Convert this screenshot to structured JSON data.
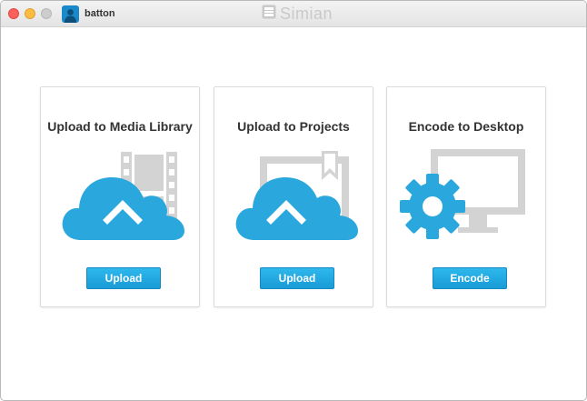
{
  "titlebar": {
    "username": "batton",
    "brand": "Simian",
    "icons": [
      "close-light",
      "minimize-light",
      "maximize-light",
      "user-avatar-icon",
      "simian-logo-icon"
    ]
  },
  "cards": [
    {
      "title": "Upload to Media Library",
      "button_label": "Upload",
      "illustration": "cloud-upload-film-icon"
    },
    {
      "title": "Upload to Projects",
      "button_label": "Upload",
      "illustration": "cloud-upload-bookmark-icon"
    },
    {
      "title": "Encode to Desktop",
      "button_label": "Encode",
      "illustration": "gear-monitor-icon"
    }
  ],
  "colors": {
    "accent": "#1a9bd7",
    "cloud": "#2aa7dd",
    "illustration_gray": "#d3d3d3",
    "text": "#333333"
  }
}
